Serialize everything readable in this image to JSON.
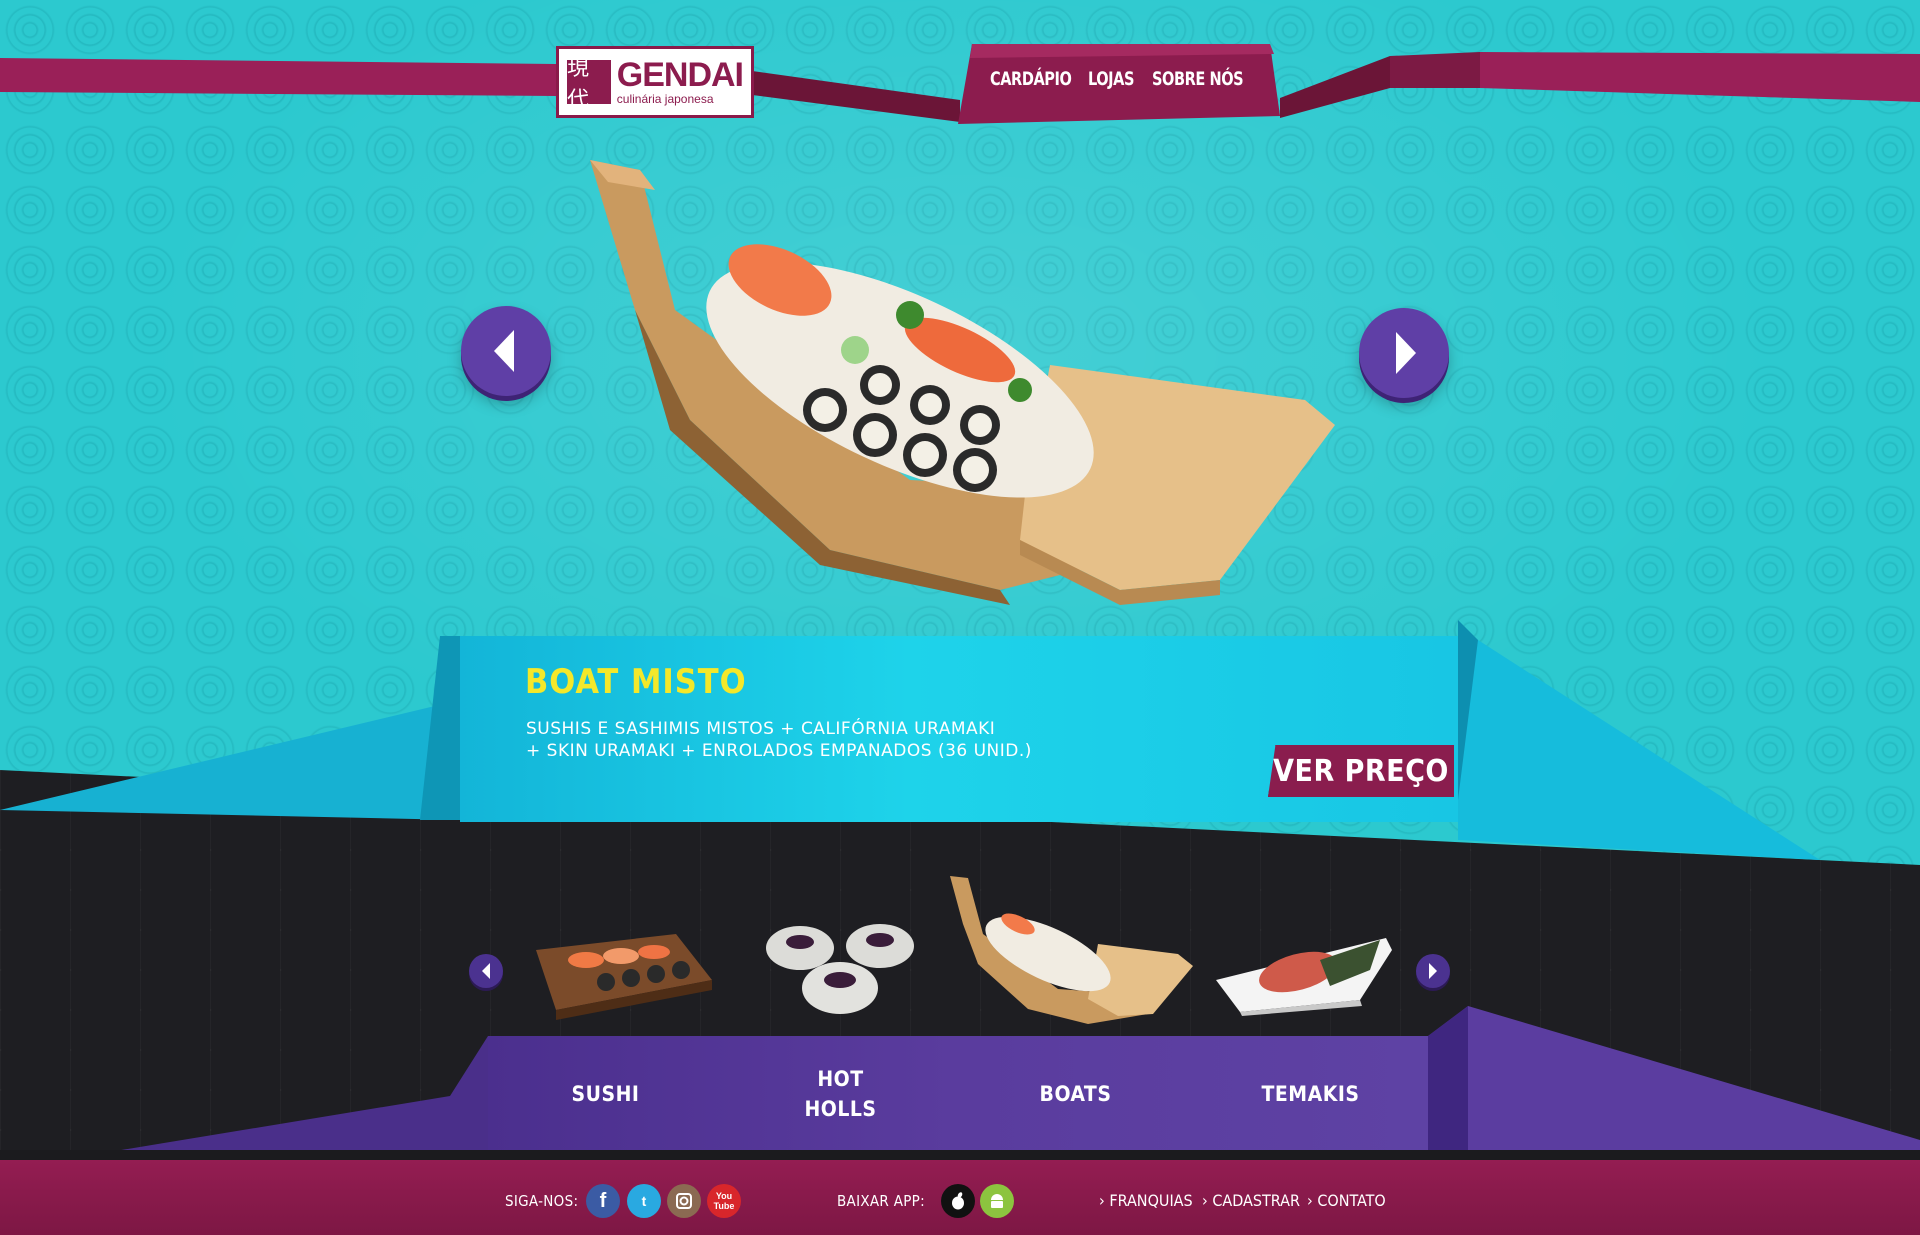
{
  "brand": {
    "name": "GENDAI",
    "tagline": "culinária japonesa",
    "mark": "現代"
  },
  "nav": {
    "items": [
      "CARDÁPIO",
      "LOJAS",
      "SOBRE NÓS"
    ]
  },
  "featured": {
    "title": "BOAT MISTO",
    "description_line1": "SUSHIS E SASHIMIS MISTOS + CALIFÓRNIA URAMAKI",
    "description_line2": "+ SKIN URAMAKI + ENROLADOS EMPANADOS (36 UNID.)",
    "cta_label": "VER PREÇO"
  },
  "categories": [
    {
      "label": "SUSHI"
    },
    {
      "label": "HOT\nHOLLS"
    },
    {
      "label": "BOATS"
    },
    {
      "label": "TEMAKIS"
    }
  ],
  "footer": {
    "follow_label": "SIGA-NOS:",
    "app_label": "BAIXAR APP:",
    "links": [
      "FRANQUIAS",
      "CADASTRAR",
      "CONTATO"
    ],
    "social_icons": [
      "facebook-icon",
      "twitter-icon",
      "instagram-icon",
      "youtube-icon"
    ],
    "app_icons": [
      "apple-icon",
      "android-icon"
    ]
  },
  "colors": {
    "teal_bg": "#2cc9cf",
    "magenta": "#8a1d4e",
    "purple": "#5f3fa6",
    "yellow_title": "#f4e82a",
    "dark_band": "#1e1e22"
  }
}
